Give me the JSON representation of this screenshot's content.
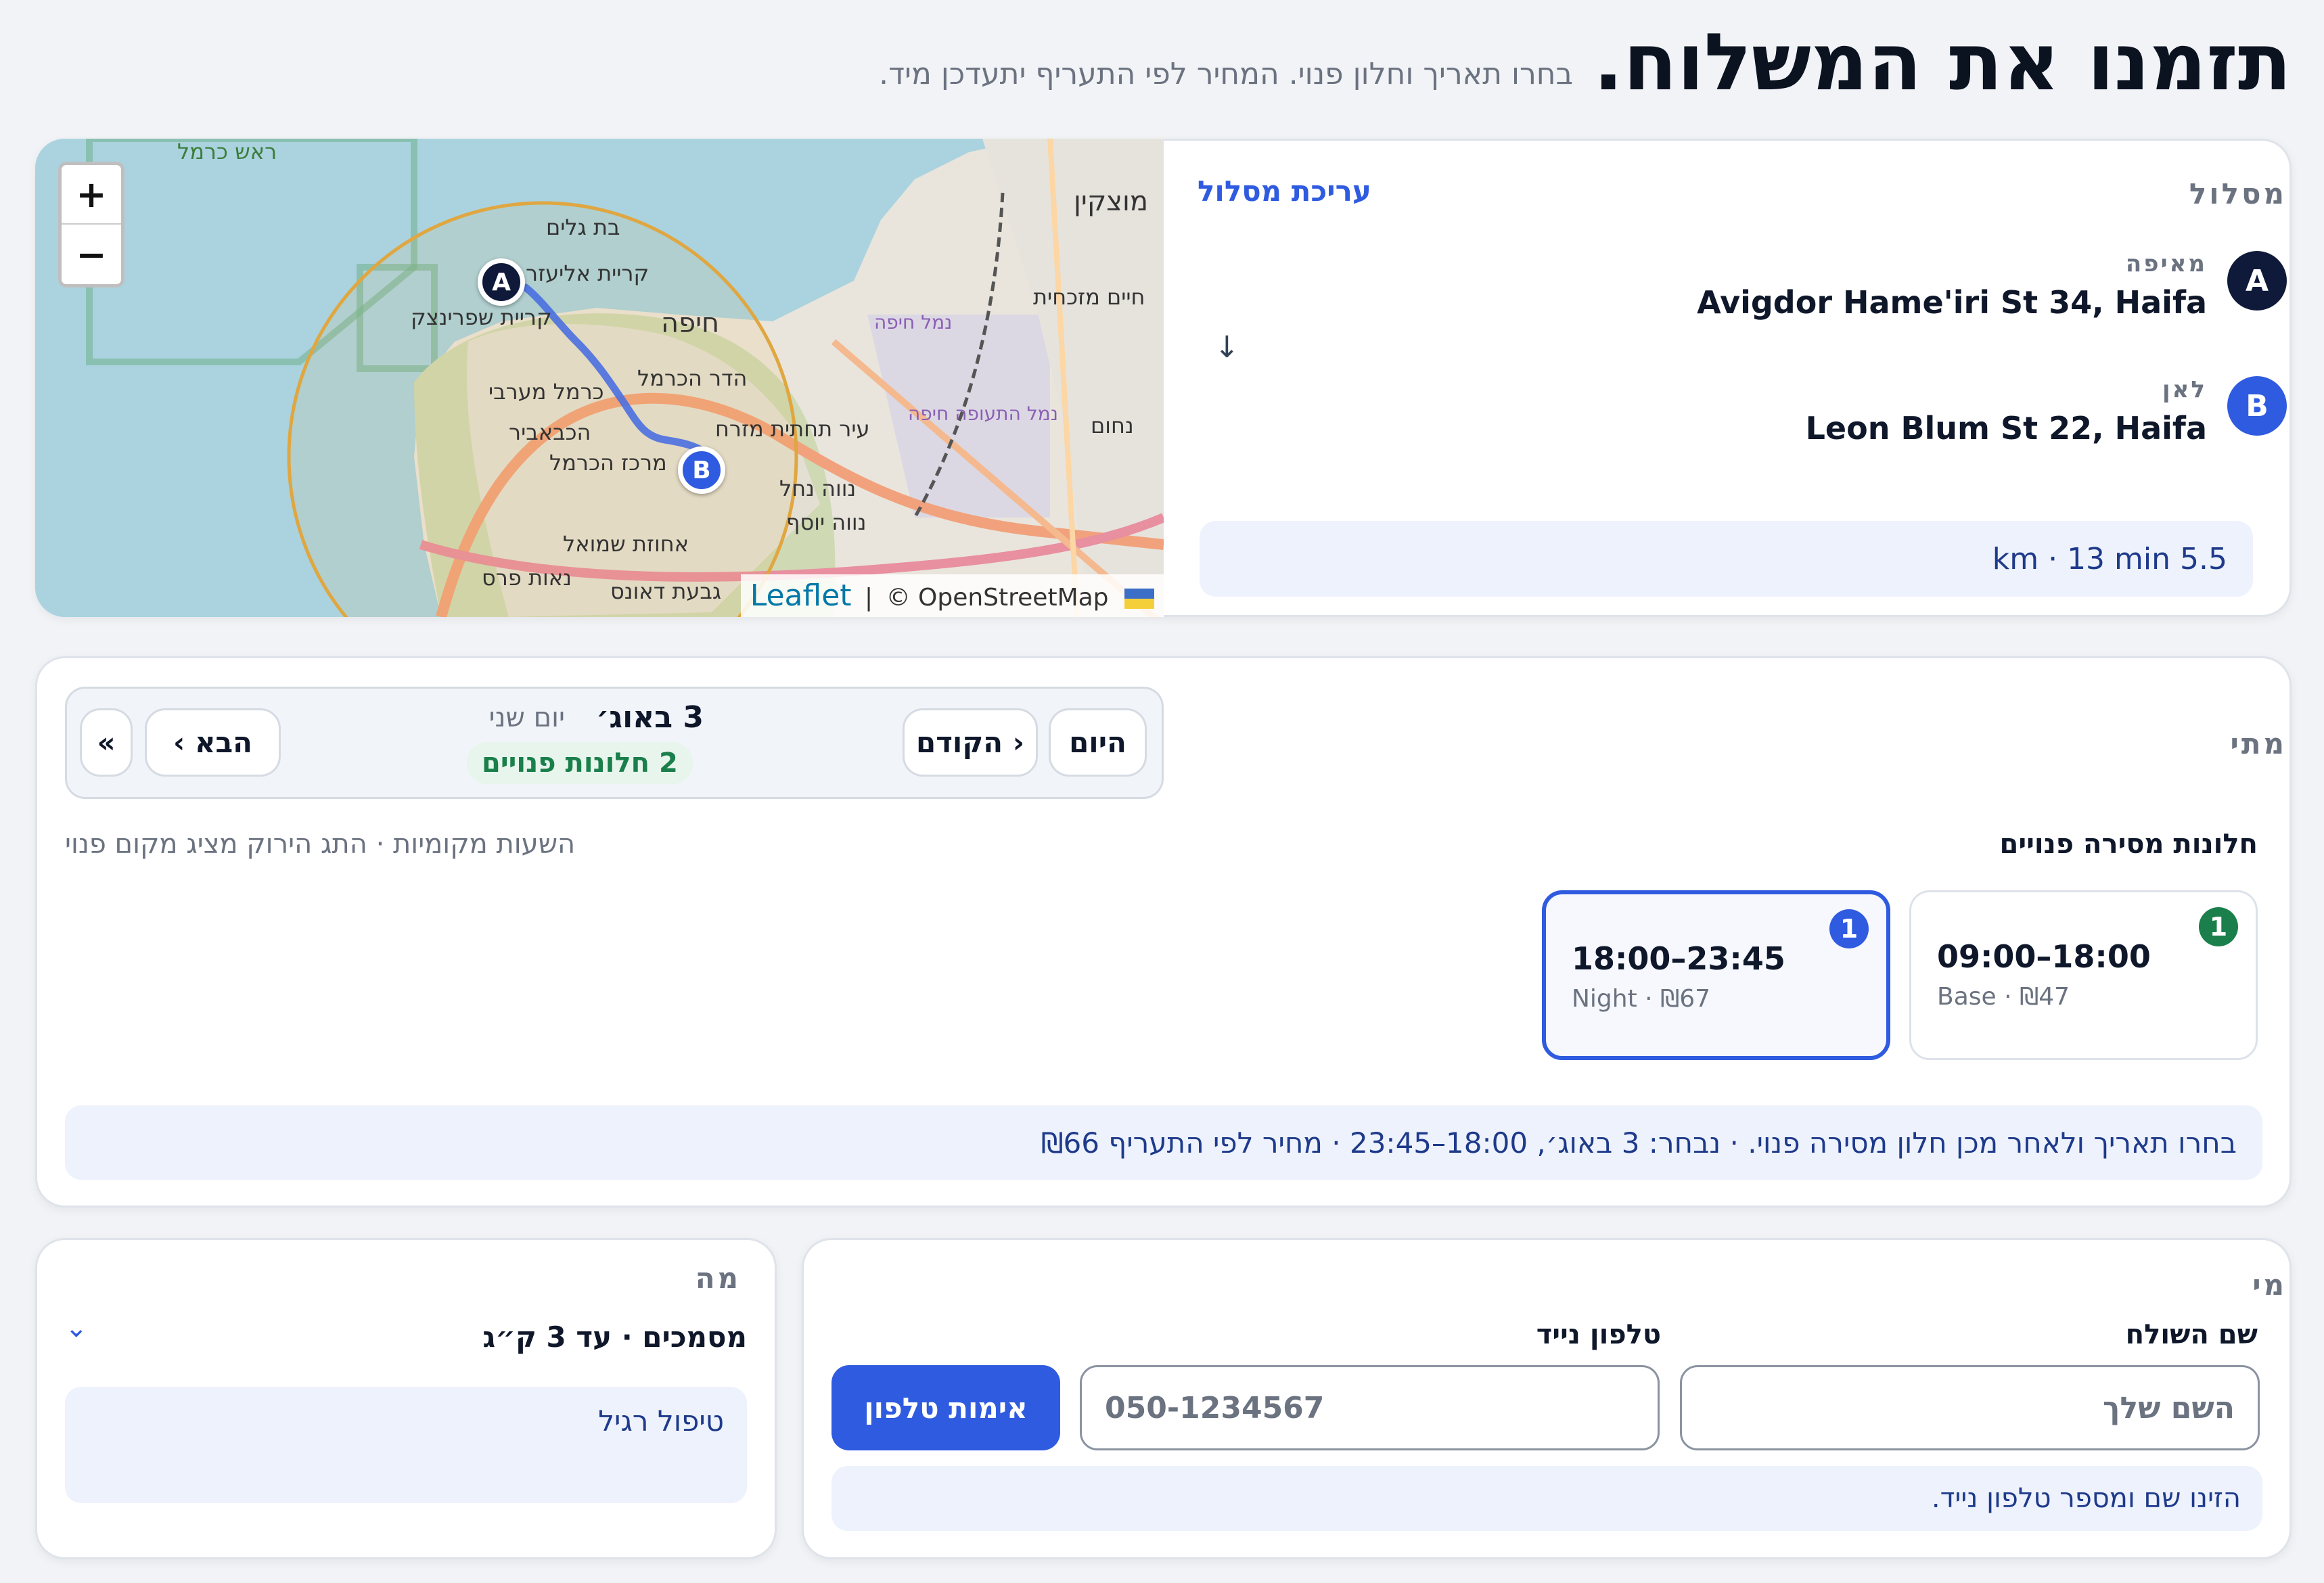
{
  "header": {
    "title": "תזמנו את המשלוח.",
    "subtitle": "בחרו תאריך וחלון פנוי. המחיר לפי התעריף יתעדכן מיד."
  },
  "route": {
    "section_label": "מסלול",
    "edit_link": "עריכת מסלול",
    "origin": {
      "badge": "A",
      "label": "מאיפה",
      "address": "Avigdor Hame'iri St 34, Haifa"
    },
    "arrow": "↓",
    "destination": {
      "badge": "B",
      "label": "לאן",
      "address": "Leon Blum St 22, Haifa"
    },
    "summary": "5.5 km · 13 min"
  },
  "map": {
    "zoom_in": "+",
    "zoom_out": "−",
    "attribution_leaflet": "Leaflet",
    "attribution_sep": "|",
    "attribution_osm": "© OpenStreetMap",
    "pin_a": "A",
    "pin_b": "B",
    "place_labels": [
      "ראש כרמל",
      "בת גלים",
      "קריית אליעזר",
      "קריית שפרינצק",
      "חיפה",
      "הדר הכרמל",
      "כרמל מערבי",
      "הכבאביר",
      "עיר תחתית מזרח",
      "מרכז הכרמל",
      "נווה נחל",
      "נווה יוסף",
      "אחוזת שמואל",
      "נאות פרס",
      "גבעת דאונס",
      "נמל חיפה",
      "נמל התעופה חיפה",
      "מוצקין",
      "חיים מזכחית",
      "נחום",
      "חיפה"
    ]
  },
  "when": {
    "section_label": "מתי",
    "today_button": "היום",
    "prev_button": "‹ הקודם",
    "next_button": "הבא ›",
    "skip_button": "»",
    "date": "3 באוג׳",
    "weekday": "יום שני",
    "available_count": "2 חלונות פנויים",
    "slots_heading": "חלונות מסירה פנויים",
    "slots_note": "השעות מקומיות · התג הירוק מציג מקום פנוי",
    "slots": [
      {
        "time": "09:00–18:00",
        "detail": "Base · ₪47",
        "badge": "1",
        "badge_color": "#1a7f4b",
        "selected": false
      },
      {
        "time": "18:00–23:45",
        "detail": "Night · ₪67",
        "badge": "1",
        "badge_color": "#2f5be0",
        "selected": true
      }
    ],
    "status": "בחרו תאריך ולאחר מכן חלון מסירה פנוי. · נבחר: 3 באוג׳, 18:00–23:45 · מחיר לפי התעריף ₪66"
  },
  "who": {
    "section_label": "מי",
    "name_label": "שם השולח",
    "name_placeholder": "השם שלך",
    "phone_label": "טלפון נייד",
    "phone_placeholder": "050-1234567",
    "verify_button": "אימות טלפון",
    "hint": "הזינו שם ומספר טלפון נייד."
  },
  "what": {
    "section_label": "מה",
    "selected_option": "מסמכים · עד 3 ק״ג",
    "chevron": "⌄",
    "handling": "טיפול רגיל"
  },
  "colors": {
    "accent": "#2f5be0",
    "dark": "#0f1a3a",
    "green": "#1a7f4b",
    "info_bg": "#edf2fd"
  }
}
